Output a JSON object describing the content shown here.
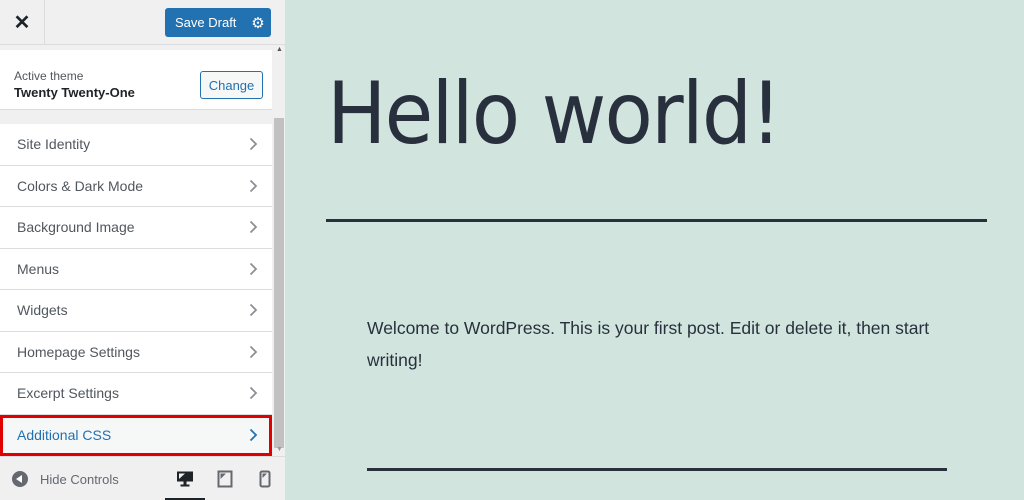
{
  "header": {
    "close_icon": "close-x-icon",
    "save_label": "Save Draft",
    "settings_icon": "gear-icon"
  },
  "theme": {
    "label": "Active theme",
    "name": "Twenty Twenty-One",
    "change_label": "Change"
  },
  "menu": {
    "items": [
      {
        "label": "Site Identity",
        "active": false
      },
      {
        "label": "Colors & Dark Mode",
        "active": false
      },
      {
        "label": "Background Image",
        "active": false
      },
      {
        "label": "Menus",
        "active": false
      },
      {
        "label": "Widgets",
        "active": false
      },
      {
        "label": "Homepage Settings",
        "active": false
      },
      {
        "label": "Excerpt Settings",
        "active": false
      },
      {
        "label": "Additional CSS",
        "active": true
      }
    ]
  },
  "footer": {
    "hide_controls_label": "Hide Controls",
    "devices": [
      "desktop",
      "tablet",
      "mobile"
    ],
    "selected_device": "desktop"
  },
  "preview": {
    "title": "Hello world!",
    "body": "Welcome to WordPress. This is your first post. Edit or delete it, then start writing!"
  },
  "colors": {
    "accent": "#2271b1",
    "highlight_border": "#e00000",
    "preview_bg": "#d1e4dd",
    "text_dark": "#28303d"
  }
}
